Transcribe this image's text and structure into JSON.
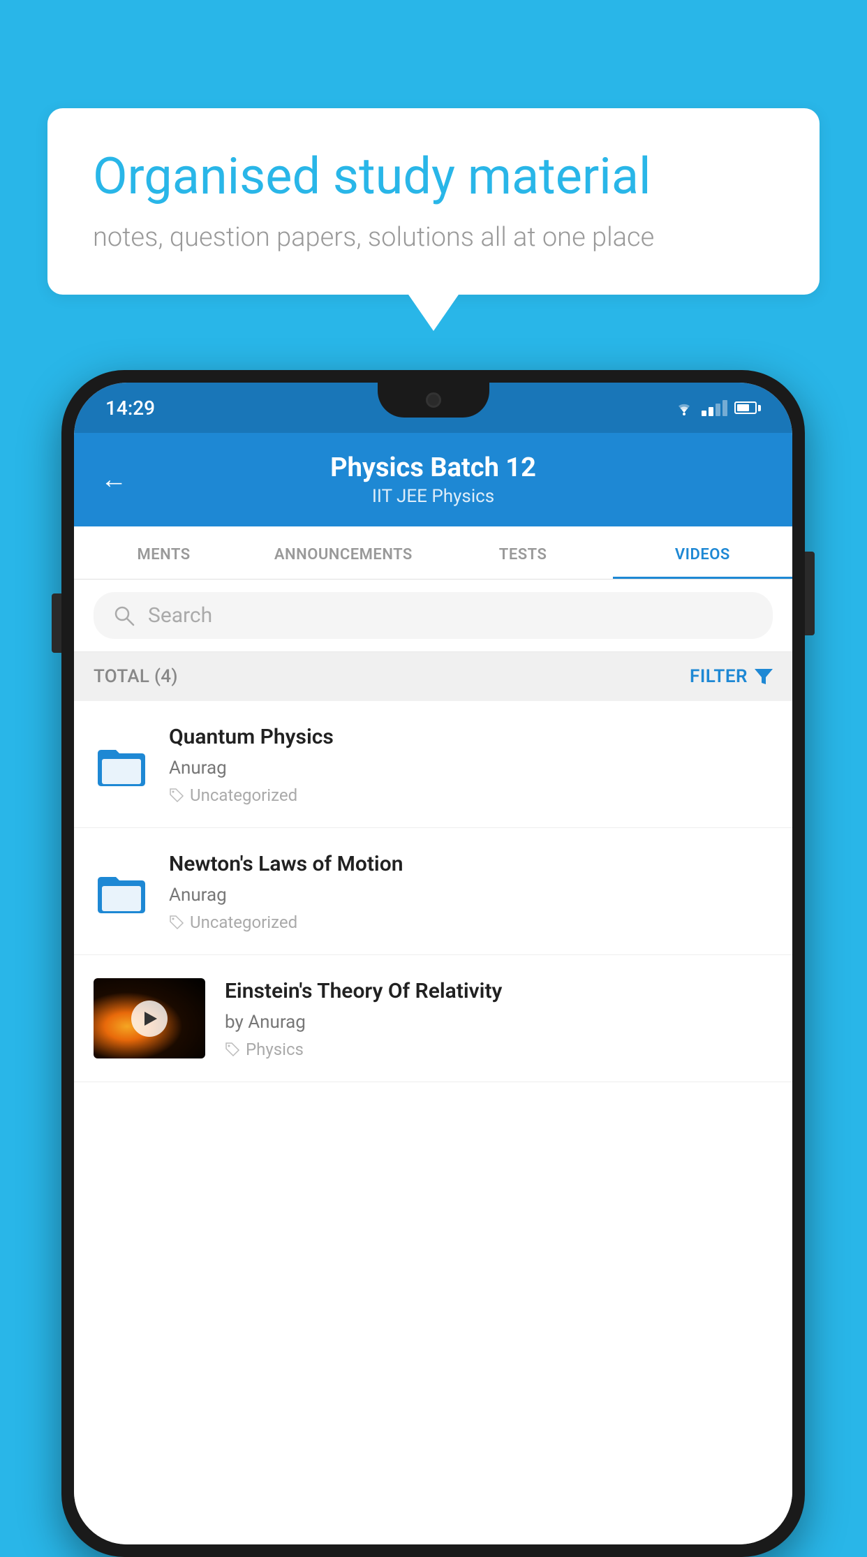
{
  "background_color": "#29b6e8",
  "speech_bubble": {
    "title": "Organised study material",
    "subtitle": "notes, question papers, solutions all at one place"
  },
  "phone": {
    "status_bar": {
      "time": "14:29",
      "wifi": true,
      "signal": true,
      "battery": true
    },
    "header": {
      "back_label": "←",
      "title": "Physics Batch 12",
      "subtitle": "IIT JEE   Physics"
    },
    "tabs": [
      {
        "label": "MENTS",
        "active": false
      },
      {
        "label": "ANNOUNCEMENTS",
        "active": false
      },
      {
        "label": "TESTS",
        "active": false
      },
      {
        "label": "VIDEOS",
        "active": true
      }
    ],
    "search": {
      "placeholder": "Search"
    },
    "filter_bar": {
      "total_label": "TOTAL (4)",
      "filter_label": "FILTER"
    },
    "videos": [
      {
        "id": 1,
        "title": "Quantum Physics",
        "author": "Anurag",
        "tag": "Uncategorized",
        "has_thumbnail": false
      },
      {
        "id": 2,
        "title": "Newton's Laws of Motion",
        "author": "Anurag",
        "tag": "Uncategorized",
        "has_thumbnail": false
      },
      {
        "id": 3,
        "title": "Einstein's Theory Of Relativity",
        "author": "by Anurag",
        "tag": "Physics",
        "has_thumbnail": true
      }
    ]
  }
}
